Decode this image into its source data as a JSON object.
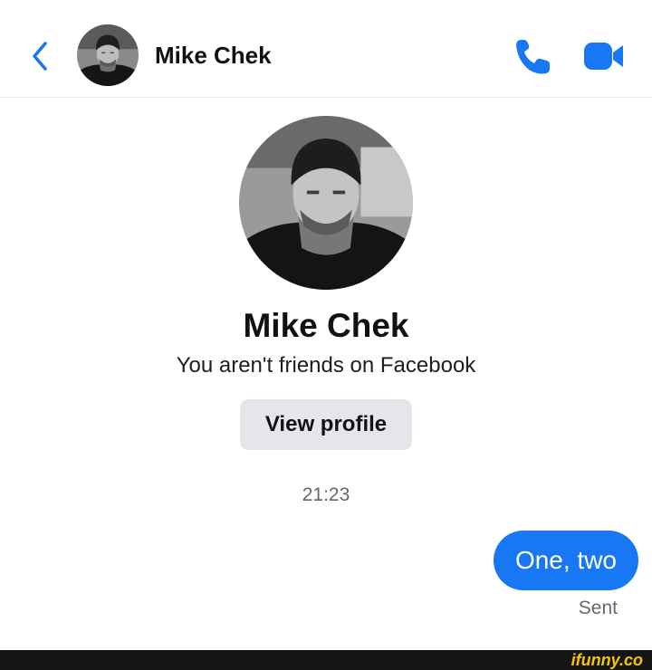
{
  "header": {
    "contact_name": "Mike Chek",
    "back_icon": "chevron-left-icon",
    "call_icon": "phone-icon",
    "video_icon": "video-camera-icon"
  },
  "profile": {
    "name": "Mike Chek",
    "subtitle": "You aren't friends on Facebook",
    "view_profile_label": "View profile"
  },
  "conversation": {
    "timestamp": "21:23",
    "messages": [
      {
        "text": "One, two",
        "from": "me",
        "status": "Sent"
      }
    ]
  },
  "watermark": {
    "text": "ifunny.co"
  },
  "colors": {
    "accent": "#1877f2",
    "bubble_text": "#ffffff",
    "secondary_text": "#65676b",
    "button_bg": "#e4e6eb",
    "watermark": "#f6c700"
  }
}
